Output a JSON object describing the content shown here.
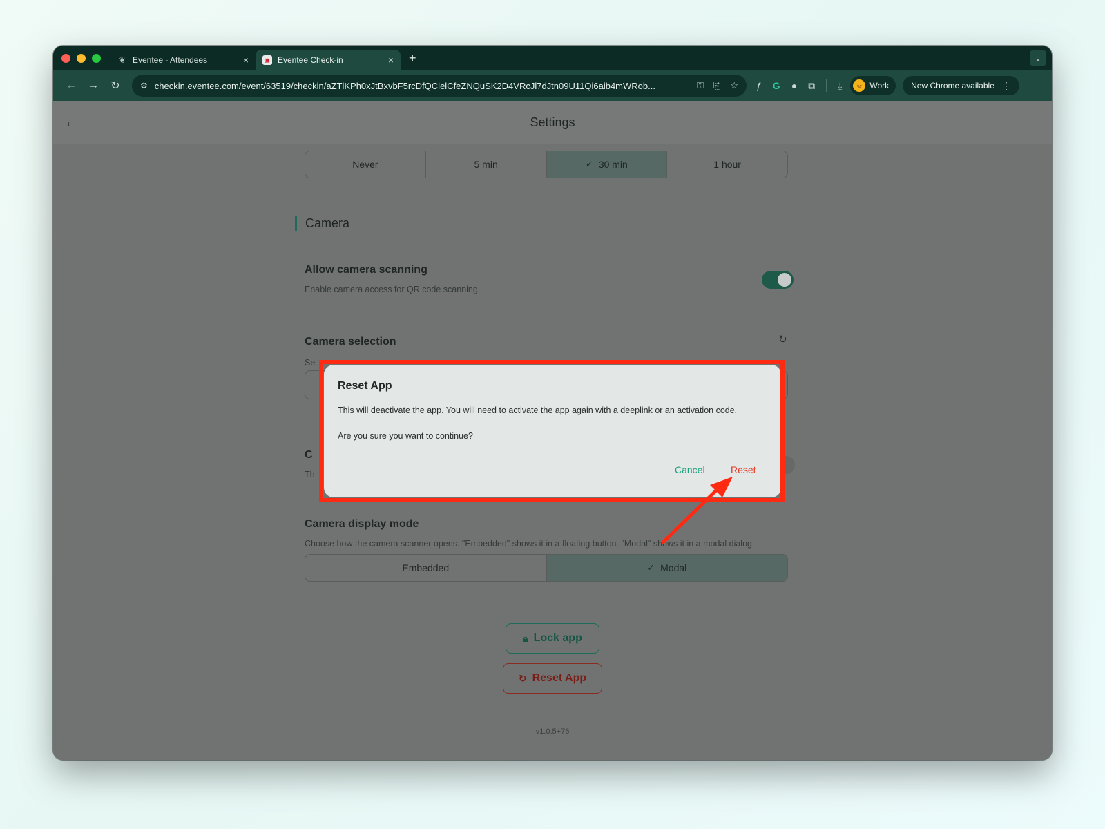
{
  "browser": {
    "tabs": [
      {
        "label": "Eventee - Attendees",
        "close": "×"
      },
      {
        "label": "Eventee Check-in",
        "close": "×"
      }
    ],
    "new_tab": "+",
    "url": "checkin.eventee.com/event/63519/checkin/aZTlKPh0xJtBxvbF5rcDfQClelCfeZNQuSK2D4VRcJl7dJtn09U11Qi6aib4mWRob...",
    "profile_label": "Work",
    "update_label": "New Chrome available"
  },
  "page": {
    "title": "Settings",
    "timeout_options": [
      {
        "label": "Never"
      },
      {
        "label": "5 min"
      },
      {
        "label": "30 min"
      },
      {
        "label": "1 hour"
      }
    ],
    "camera": {
      "section_title": "Camera",
      "allow_title": "Allow camera scanning",
      "allow_desc": "Enable camera access for QR code scanning.",
      "selection_title": "Camera selection",
      "selection_desc_partial": "Se",
      "hidden_title_partial": "C",
      "hidden_desc_partial": "Th",
      "display_title": "Camera display mode",
      "display_desc": "Choose how the camera scanner opens. \"Embedded\" shows it in a floating button. \"Modal\" shows it in a modal dialog.",
      "display_options": [
        {
          "label": "Embedded"
        },
        {
          "label": "Modal"
        }
      ]
    },
    "lock_label": "Lock app",
    "reset_label": "Reset App",
    "version": "v1.0.5+76"
  },
  "dialog": {
    "title": "Reset App",
    "body_1": "This will deactivate the app. You will need to activate the app again with a deeplink or an activation code.",
    "body_2": "Are you sure you want to continue?",
    "cancel_label": "Cancel",
    "reset_label": "Reset"
  },
  "colors": {
    "accent": "#1d6b58",
    "danger": "#e53925",
    "highlight": "#ff2a12"
  }
}
